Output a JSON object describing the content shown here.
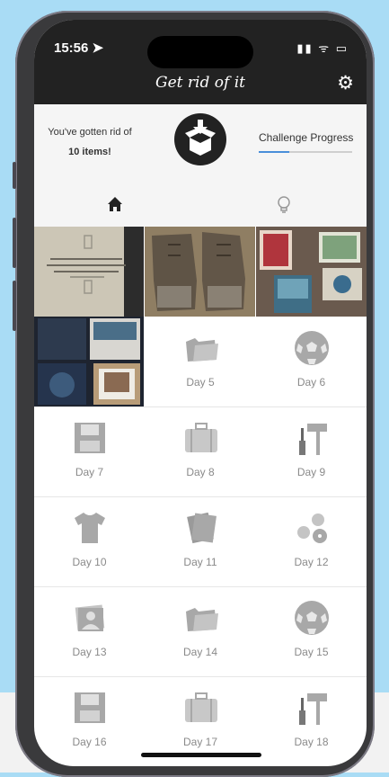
{
  "status_bar": {
    "time": "15:56 ➤",
    "icons": "▮▮ ᯤ ▭"
  },
  "header": {
    "title": "Get rid of it",
    "settings_icon": "gear-icon"
  },
  "summary": {
    "line1": "You've gotten rid of",
    "count": "10 items!",
    "challenge_label": "Challenge Progress",
    "challenge_progress": 0.33
  },
  "tabs": [
    {
      "name": "home",
      "icon": "home-icon",
      "active": true
    },
    {
      "name": "ideas",
      "icon": "lightbulb-icon",
      "active": false
    }
  ],
  "colors": {
    "accent": "#4a8fd9",
    "header_bg": "#222222",
    "icon_gray": "#a8a8a8"
  },
  "photos": [
    {
      "name": "photo-book",
      "subject": "book"
    },
    {
      "name": "photo-boots",
      "subject": "boots"
    },
    {
      "name": "photo-cards",
      "subject": "cards"
    },
    {
      "name": "photo-dvds",
      "subject": "dvds"
    }
  ],
  "days": [
    {
      "label": "Day 5",
      "icon": "folder-icon"
    },
    {
      "label": "Day 6",
      "icon": "soccer-ball-icon"
    },
    {
      "label": "Day 7",
      "icon": "floppy-disk-icon"
    },
    {
      "label": "Day 8",
      "icon": "suitcase-icon"
    },
    {
      "label": "Day 9",
      "icon": "tools-icon"
    },
    {
      "label": "Day 10",
      "icon": "tshirt-icon"
    },
    {
      "label": "Day 11",
      "icon": "books-icon"
    },
    {
      "label": "Day 12",
      "icon": "discs-icon"
    },
    {
      "label": "Day 13",
      "icon": "photos-icon"
    },
    {
      "label": "Day 14",
      "icon": "folder-icon"
    },
    {
      "label": "Day 15",
      "icon": "soccer-ball-icon"
    },
    {
      "label": "Day 16",
      "icon": "floppy-disk-icon"
    },
    {
      "label": "Day 17",
      "icon": "suitcase-icon"
    },
    {
      "label": "Day 18",
      "icon": "tools-icon"
    }
  ]
}
